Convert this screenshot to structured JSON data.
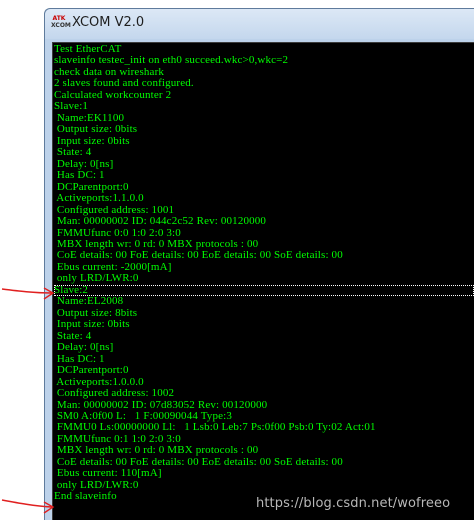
{
  "window": {
    "title": "XCOM V2.0",
    "icon_top": "ATK",
    "icon_bottom": "XCOM"
  },
  "console": {
    "lines": [
      "Test EtherCAT",
      "slaveinfo testec_init on eth0 succeed.wkc>0,wkc=2",
      "check data on wireshark",
      "2 slaves found and configured.",
      "Calculated workcounter 2",
      "Slave:1",
      " Name:EK1100",
      " Output size: 0bits",
      " Input size: 0bits",
      " State: 4",
      " Delay: 0[ns]",
      " Has DC: 1",
      " DCParentport:0",
      " Activeports:1.1.0.0",
      " Configured address: 1001",
      " Man: 00000002 ID: 044c2c52 Rev: 00120000",
      " FMMUfunc 0:0 1:0 2:0 3:0",
      " MBX length wr: 0 rd: 0 MBX protocols : 00",
      " CoE details: 00 FoE details: 00 EoE details: 00 SoE details: 00",
      " Ebus current: -2000[mA]",
      " only LRD/LWR:0",
      "Slave:2",
      " Name:EL2008",
      " Output size: 8bits",
      " Input size: 0bits",
      " State: 4",
      " Delay: 0[ns]",
      " Has DC: 1",
      " DCParentport:0",
      " Activeports:1.0.0.0",
      " Configured address: 1002",
      " Man: 00000002 ID: 07d83052 Rev: 00120000",
      " SM0 A:0f00 L:   1 F:00090044 Type:3",
      " FMMU0 Ls:00000000 Ll:   1 Lsb:0 Leb:7 Ps:0f00 Psb:0 Ty:02 Act:01",
      " FMMUfunc 0:1 1:0 2:0 3:0",
      " MBX length wr: 0 rd: 0 MBX protocols : 00",
      " CoE details: 00 FoE details: 00 EoE details: 00 SoE details: 00",
      " Ebus current: 110[mA]",
      " only LRD/LWR:0",
      "End slaveinfo"
    ]
  },
  "watermark": "https://blog.csdn.net/wofreeo",
  "colors": {
    "console_bg": "#000000",
    "console_text": "#00ff00",
    "annotation": "#e02020"
  }
}
